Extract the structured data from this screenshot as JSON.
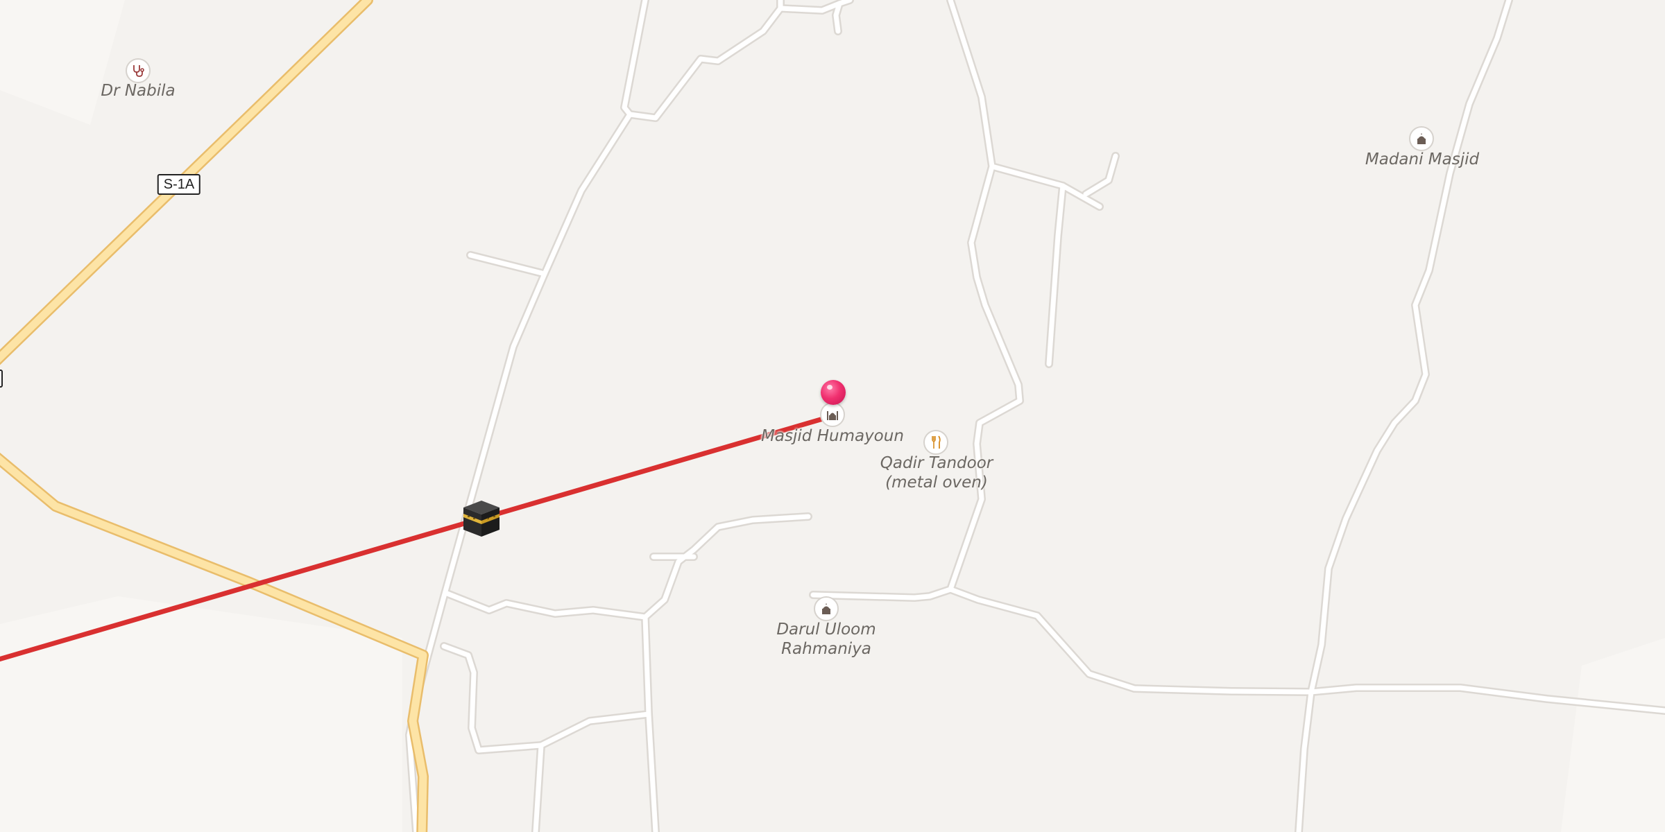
{
  "map": {
    "route_shields": [
      "S-1A"
    ],
    "pois": [
      {
        "name": "Dr Nabila",
        "icon": "stethoscope-icon"
      },
      {
        "name": "Madani Masjid",
        "icon": "mosque-icon"
      },
      {
        "name": "Masjid Humayoun",
        "icon": "mosque-icon"
      },
      {
        "name": "Qadir Tandoor (metal oven)",
        "lines": [
          "Qadir Tandoor",
          "(metal oven)"
        ],
        "icon": "restaurant-icon"
      },
      {
        "name": "Darul Uloom Rahmaniya",
        "lines": [
          "Darul Uloom",
          "Rahmaniya"
        ],
        "icon": "mosque-icon"
      }
    ],
    "markers": [
      {
        "type": "location-pin",
        "color": "#e91e63"
      },
      {
        "type": "kaaba-icon",
        "description": "Qibla direction marker"
      }
    ],
    "qibla_line_color": "#d93030",
    "colors": {
      "background": "#f4f2ef",
      "minor_road": "#ffffff",
      "primary_road": "#fde4a6",
      "primary_road_casing": "#e9bd6b"
    }
  }
}
